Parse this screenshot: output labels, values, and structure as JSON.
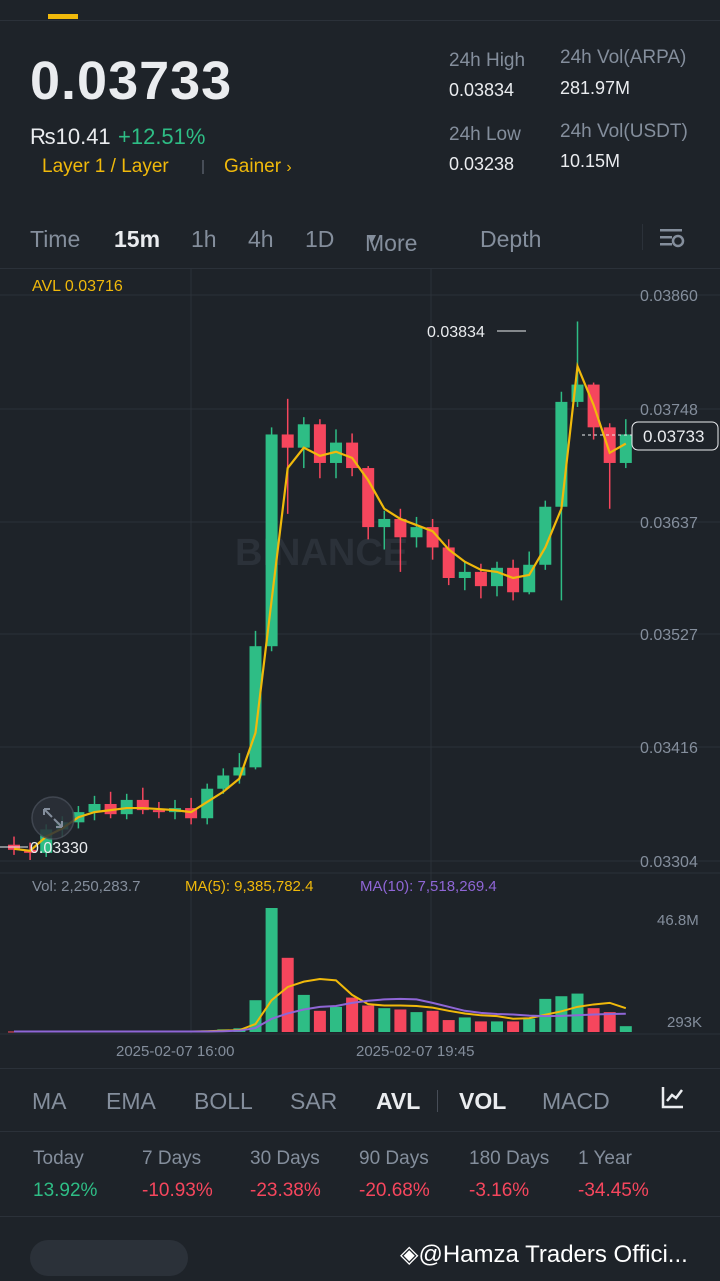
{
  "header": {
    "price": "0.03733",
    "fiat": "₨10.41",
    "change": "+12.51%",
    "tag1": "Layer 1 / Layer",
    "tag2": "Gainer",
    "high_label": "24h High",
    "high_val": "0.03834",
    "low_label": "24h Low",
    "low_val": "0.03238",
    "vol1_label": "24h Vol(ARPA)",
    "vol1_val": "281.97M",
    "vol2_label": "24h Vol(USDT)",
    "vol2_val": "10.15M"
  },
  "tabs": [
    "Time",
    "15m",
    "1h",
    "4h",
    "1D",
    "More",
    "Depth"
  ],
  "active_tab": "15m",
  "chart": {
    "avl_label": "AVL 0.03716",
    "y_ticks": [
      "0.03860",
      "0.03748",
      "0.03637",
      "0.03527",
      "0.03416",
      "0.03304"
    ],
    "high_marker": "0.03834",
    "low_marker": "0.03330",
    "current_marker": "0.03733",
    "watermark": "BINANCE",
    "vol_label": "Vol: 2,250,283.7",
    "ma5_label": "MA(5): 9,385,782.4",
    "ma10_label": "MA(10): 7,518,269.4",
    "vol_top": "46.8M",
    "vol_bottom": "293K",
    "x_labels": [
      "2025-02-07 16:00",
      "2025-02-07 19:45"
    ]
  },
  "chart_data": {
    "type": "candlestick",
    "ylim": [
      0.03304,
      0.0386
    ],
    "candles": [
      {
        "o": 0.0332,
        "h": 0.03328,
        "l": 0.0331,
        "c": 0.03315
      },
      {
        "o": 0.03315,
        "h": 0.03322,
        "l": 0.03305,
        "c": 0.03312
      },
      {
        "o": 0.03312,
        "h": 0.0334,
        "l": 0.03308,
        "c": 0.03335
      },
      {
        "o": 0.03335,
        "h": 0.03348,
        "l": 0.03328,
        "c": 0.03342
      },
      {
        "o": 0.03342,
        "h": 0.03358,
        "l": 0.03336,
        "c": 0.03352
      },
      {
        "o": 0.03352,
        "h": 0.03368,
        "l": 0.03344,
        "c": 0.0336
      },
      {
        "o": 0.0336,
        "h": 0.03372,
        "l": 0.03346,
        "c": 0.0335
      },
      {
        "o": 0.0335,
        "h": 0.0337,
        "l": 0.03345,
        "c": 0.03364
      },
      {
        "o": 0.03364,
        "h": 0.03376,
        "l": 0.0335,
        "c": 0.03354
      },
      {
        "o": 0.03354,
        "h": 0.03362,
        "l": 0.03346,
        "c": 0.03352
      },
      {
        "o": 0.03352,
        "h": 0.03364,
        "l": 0.03345,
        "c": 0.03356
      },
      {
        "o": 0.03356,
        "h": 0.03366,
        "l": 0.0334,
        "c": 0.03346
      },
      {
        "o": 0.03346,
        "h": 0.0338,
        "l": 0.0334,
        "c": 0.03375
      },
      {
        "o": 0.03375,
        "h": 0.03395,
        "l": 0.0337,
        "c": 0.03388
      },
      {
        "o": 0.03388,
        "h": 0.0341,
        "l": 0.0338,
        "c": 0.03396
      },
      {
        "o": 0.03396,
        "h": 0.0353,
        "l": 0.03394,
        "c": 0.03515
      },
      {
        "o": 0.03515,
        "h": 0.0373,
        "l": 0.0351,
        "c": 0.03723
      },
      {
        "o": 0.03723,
        "h": 0.03758,
        "l": 0.03645,
        "c": 0.0371
      },
      {
        "o": 0.0371,
        "h": 0.0374,
        "l": 0.0369,
        "c": 0.03733
      },
      {
        "o": 0.03733,
        "h": 0.03738,
        "l": 0.0368,
        "c": 0.03695
      },
      {
        "o": 0.03695,
        "h": 0.03728,
        "l": 0.0368,
        "c": 0.03715
      },
      {
        "o": 0.03715,
        "h": 0.03724,
        "l": 0.03682,
        "c": 0.0369
      },
      {
        "o": 0.0369,
        "h": 0.03692,
        "l": 0.0362,
        "c": 0.03632
      },
      {
        "o": 0.03632,
        "h": 0.03648,
        "l": 0.0361,
        "c": 0.0364
      },
      {
        "o": 0.0364,
        "h": 0.0365,
        "l": 0.03588,
        "c": 0.03622
      },
      {
        "o": 0.03622,
        "h": 0.03642,
        "l": 0.03612,
        "c": 0.03632
      },
      {
        "o": 0.03632,
        "h": 0.0364,
        "l": 0.036,
        "c": 0.03612
      },
      {
        "o": 0.03612,
        "h": 0.0362,
        "l": 0.03575,
        "c": 0.03582
      },
      {
        "o": 0.03582,
        "h": 0.03598,
        "l": 0.0357,
        "c": 0.03588
      },
      {
        "o": 0.03588,
        "h": 0.03596,
        "l": 0.03562,
        "c": 0.03574
      },
      {
        "o": 0.03574,
        "h": 0.03598,
        "l": 0.03564,
        "c": 0.03592
      },
      {
        "o": 0.03592,
        "h": 0.036,
        "l": 0.0356,
        "c": 0.03568
      },
      {
        "o": 0.03568,
        "h": 0.03608,
        "l": 0.03566,
        "c": 0.03595
      },
      {
        "o": 0.03595,
        "h": 0.03658,
        "l": 0.0359,
        "c": 0.03652
      },
      {
        "o": 0.03652,
        "h": 0.03765,
        "l": 0.0356,
        "c": 0.03755
      },
      {
        "o": 0.03755,
        "h": 0.03834,
        "l": 0.0375,
        "c": 0.03772
      },
      {
        "o": 0.03772,
        "h": 0.03774,
        "l": 0.03718,
        "c": 0.0373
      },
      {
        "o": 0.0373,
        "h": 0.03734,
        "l": 0.0365,
        "c": 0.03695
      },
      {
        "o": 0.03695,
        "h": 0.03738,
        "l": 0.0369,
        "c": 0.03723
      }
    ],
    "avl": [
      0.03316,
      0.03314,
      0.03328,
      0.03336,
      0.03347,
      0.03352,
      0.03354,
      0.03356,
      0.03356,
      0.03355,
      0.03354,
      0.03352,
      0.03362,
      0.03372,
      0.03385,
      0.0343,
      0.0356,
      0.0369,
      0.0371,
      0.03702,
      0.03706,
      0.037,
      0.03678,
      0.0365,
      0.0364,
      0.03634,
      0.03628,
      0.0361,
      0.03598,
      0.0359,
      0.03588,
      0.03582,
      0.03585,
      0.03612,
      0.0365,
      0.0379,
      0.03752,
      0.03705,
      0.03714
    ],
    "volumes": [
      0.2,
      0.2,
      0.3,
      0.2,
      0.3,
      0.2,
      0.2,
      0.2,
      0.2,
      0.2,
      0.2,
      0.2,
      0.6,
      1.0,
      1.4,
      12.0,
      46.8,
      28.0,
      14.0,
      8.0,
      9.5,
      13.0,
      10.0,
      9.0,
      8.5,
      7.5,
      8.0,
      4.5,
      5.5,
      4.0,
      4.0,
      4.0,
      5.0,
      12.5,
      13.5,
      14.5,
      9.0,
      7.5,
      2.2
    ],
    "ma5": [
      0.2,
      0.2,
      0.2,
      0.2,
      0.2,
      0.2,
      0.2,
      0.2,
      0.2,
      0.2,
      0.2,
      0.2,
      0.3,
      0.5,
      0.7,
      3.0,
      12.0,
      17.0,
      19.0,
      20.0,
      19.5,
      14.0,
      10.5,
      10.0,
      10.0,
      9.8,
      9.2,
      8.0,
      7.0,
      6.3,
      6.0,
      5.0,
      5.2,
      6.5,
      7.8,
      9.5,
      10.4,
      11.0,
      9.0
    ],
    "ma10": [
      0.2,
      0.2,
      0.2,
      0.2,
      0.2,
      0.2,
      0.2,
      0.2,
      0.2,
      0.2,
      0.2,
      0.2,
      0.2,
      0.3,
      0.5,
      1.5,
      5.0,
      7.0,
      8.5,
      9.5,
      9.8,
      11.0,
      11.8,
      12.3,
      12.5,
      12.3,
      11.0,
      9.5,
      8.0,
      7.2,
      6.8,
      6.6,
      6.2,
      6.0,
      6.1,
      6.3,
      6.6,
      6.8,
      6.9
    ]
  },
  "bottom_tabs": [
    "MA",
    "EMA",
    "BOLL",
    "SAR",
    "AVL",
    "VOL",
    "MACD"
  ],
  "performance": {
    "labels": [
      "Today",
      "7 Days",
      "30 Days",
      "90 Days",
      "180 Days",
      "1 Year"
    ],
    "values": [
      "13.92%",
      "-10.93%",
      "-23.38%",
      "-20.68%",
      "-3.16%",
      "-34.45%"
    ]
  },
  "footer": {
    "watermark": "@Hamza Traders Offici..."
  }
}
